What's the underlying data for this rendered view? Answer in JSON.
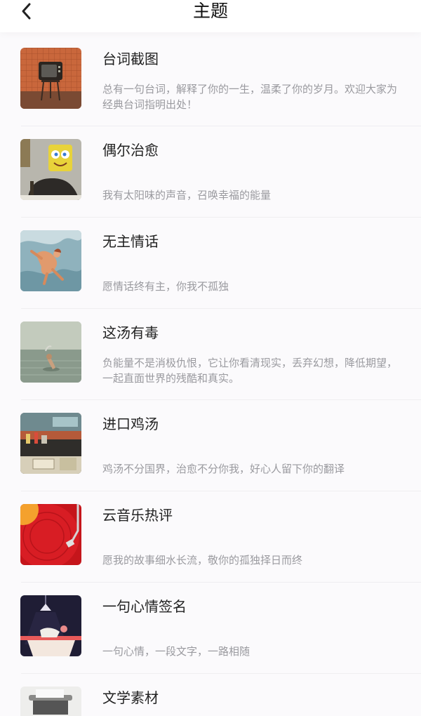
{
  "header": {
    "title": "主题",
    "back_icon": "chevron-left-icon"
  },
  "themes": [
    {
      "name": "台词截图",
      "description": "总有一句台词，解释了你的一生，温柔了你的岁月。欢迎大家为经典台词指明出处！",
      "image": "vintage-tv-thumbnail"
    },
    {
      "name": "偶尔治愈",
      "description": "我有太阳味的声音，召唤幸福的能量",
      "image": "spongebob-head-person-thumbnail"
    },
    {
      "name": "无主情话",
      "description": "愿情话终有主，你我不孤独",
      "image": "floating-figure-painting-thumbnail"
    },
    {
      "name": "这汤有毒",
      "description": "负能量不是消极仇恨，它让你看清现实，丢弃幻想，降低期望，一起直面世界的残酷和真实。",
      "image": "person-in-water-thumbnail"
    },
    {
      "name": "进口鸡汤",
      "description": "鸡汤不分国界，治愈不分你我，好心人留下你的翻译",
      "image": "diner-counter-thumbnail"
    },
    {
      "name": "云音乐热评",
      "description": "愿我的故事细水长流，敬你的孤独择日而终",
      "image": "vinyl-record-thumbnail"
    },
    {
      "name": "一句心情签名",
      "description": "一句心情，一段文字，一路相随",
      "image": "night-desk-lamp-thumbnail"
    },
    {
      "name": "文学素材",
      "description": "",
      "image": "typewriter-thumbnail"
    }
  ]
}
